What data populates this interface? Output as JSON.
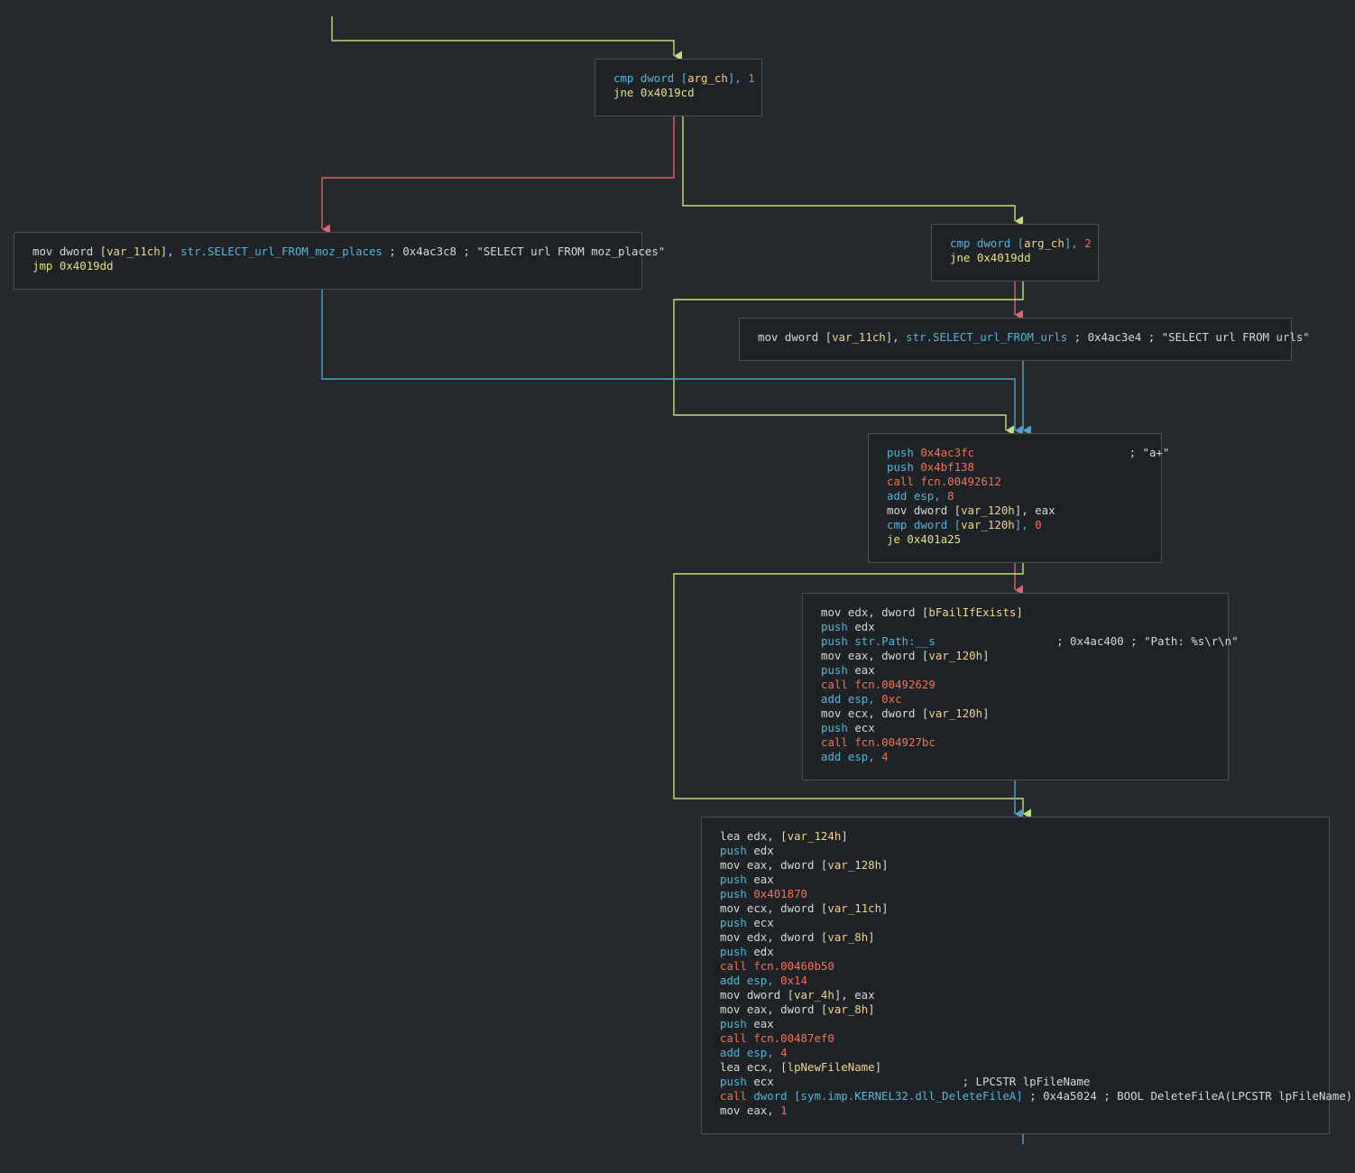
{
  "colors": {
    "background": "#25292d",
    "block_bg": "#1e2125",
    "block_border": "#4a4f55",
    "edge_true": "#bde07a",
    "edge_false": "#e0636b",
    "edge_uncond": "#4fa3c4",
    "mnemonic_default": "#d7dadc",
    "mnemonic_cyan": "#52b8d6",
    "mnemonic_call": "#f0745a",
    "mnemonic_jump": "#e5e27d",
    "operand_var": "#f0d58c",
    "operand_number": "#f0745a"
  },
  "blocks": [
    {
      "id": "b1",
      "lines": [
        {
          "mn": "cmp",
          "c": "cmp",
          "ops": [
            [
              "dword [",
              "c"
            ],
            [
              "arg_ch",
              "y"
            ],
            [
              "], ",
              "c"
            ],
            [
              "1",
              "o"
            ]
          ]
        },
        {
          "mn": "jne",
          "c": "jne",
          "ops": [
            [
              "0x4019cd",
              "j"
            ]
          ]
        }
      ]
    },
    {
      "id": "b2",
      "lines": [
        {
          "mn": "mov",
          "c": "mov",
          "ops": [
            [
              "dword [",
              "w"
            ],
            [
              "var_11ch",
              "y"
            ],
            [
              "], ",
              "w"
            ],
            [
              "str.SELECT_url_FROM_moz_places",
              "c"
            ]
          ],
          "cm": " ; 0x4ac3c8 ; \"SELECT url FROM moz_places\""
        },
        {
          "mn": "jmp",
          "c": "jmp",
          "ops": [
            [
              "0x4019dd",
              "j"
            ]
          ]
        }
      ]
    },
    {
      "id": "b3",
      "lines": [
        {
          "mn": "cmp",
          "c": "cmp",
          "ops": [
            [
              "dword [",
              "c"
            ],
            [
              "arg_ch",
              "y"
            ],
            [
              "], ",
              "c"
            ],
            [
              "2",
              "o"
            ]
          ]
        },
        {
          "mn": "jne",
          "c": "jne",
          "ops": [
            [
              "0x4019dd",
              "j"
            ]
          ]
        }
      ]
    },
    {
      "id": "b4",
      "lines": [
        {
          "mn": "mov",
          "c": "mov",
          "ops": [
            [
              "dword [",
              "w"
            ],
            [
              "var_11ch",
              "y"
            ],
            [
              "], ",
              "w"
            ],
            [
              "str.SELECT_url_FROM_urls",
              "c"
            ]
          ],
          "cm": " ; 0x4ac3e4 ; \"SELECT url FROM urls\""
        }
      ]
    },
    {
      "id": "b5",
      "lines": [
        {
          "mn": "push",
          "c": "push",
          "ops": [
            [
              "0x4ac3fc",
              "o"
            ]
          ],
          "cm": "                       ; \"a+\""
        },
        {
          "mn": "push",
          "c": "push",
          "ops": [
            [
              "0x4bf138",
              "o"
            ]
          ]
        },
        {
          "mn": "call",
          "c": "call",
          "ops": [
            [
              "fcn.00492612",
              "o"
            ]
          ]
        },
        {
          "mn": "add",
          "c": "add",
          "ops": [
            [
              "esp, ",
              "c"
            ],
            [
              "8",
              "o"
            ]
          ]
        },
        {
          "mn": "mov",
          "c": "mov",
          "ops": [
            [
              "dword [",
              "w"
            ],
            [
              "var_120h",
              "y"
            ],
            [
              "], eax",
              "w"
            ]
          ]
        },
        {
          "mn": "cmp",
          "c": "cmp",
          "ops": [
            [
              "dword [",
              "c"
            ],
            [
              "var_120h",
              "y"
            ],
            [
              "], ",
              "c"
            ],
            [
              "0",
              "o"
            ]
          ]
        },
        {
          "mn": "je",
          "c": "je",
          "ops": [
            [
              "0x401a25",
              "j"
            ]
          ]
        }
      ]
    },
    {
      "id": "b6",
      "lines": [
        {
          "mn": "mov",
          "c": "mov",
          "ops": [
            [
              "edx, dword [",
              "w"
            ],
            [
              "bFailIfExists",
              "y"
            ],
            [
              "]",
              "w"
            ]
          ]
        },
        {
          "mn": "push",
          "c": "push",
          "ops": [
            [
              "edx",
              "w"
            ]
          ]
        },
        {
          "mn": "push",
          "c": "push",
          "ops": [
            [
              "str.Path:__s",
              "c"
            ]
          ],
          "cm": "                  ; 0x4ac400 ; \"Path: %s\\r\\n\""
        },
        {
          "mn": "mov",
          "c": "mov",
          "ops": [
            [
              "eax, dword [",
              "w"
            ],
            [
              "var_120h",
              "y"
            ],
            [
              "]",
              "w"
            ]
          ]
        },
        {
          "mn": "push",
          "c": "push",
          "ops": [
            [
              "eax",
              "w"
            ]
          ]
        },
        {
          "mn": "call",
          "c": "call",
          "ops": [
            [
              "fcn.00492629",
              "o"
            ]
          ]
        },
        {
          "mn": "add",
          "c": "add",
          "ops": [
            [
              "esp, ",
              "c"
            ],
            [
              "0xc",
              "o"
            ]
          ]
        },
        {
          "mn": "mov",
          "c": "mov",
          "ops": [
            [
              "ecx, dword [",
              "w"
            ],
            [
              "var_120h",
              "y"
            ],
            [
              "]",
              "w"
            ]
          ]
        },
        {
          "mn": "push",
          "c": "push",
          "ops": [
            [
              "ecx",
              "w"
            ]
          ]
        },
        {
          "mn": "call",
          "c": "call",
          "ops": [
            [
              "fcn.004927bc",
              "o"
            ]
          ]
        },
        {
          "mn": "add",
          "c": "add",
          "ops": [
            [
              "esp, ",
              "c"
            ],
            [
              "4",
              "o"
            ]
          ]
        }
      ]
    },
    {
      "id": "b7",
      "lines": [
        {
          "mn": "lea",
          "c": "mov",
          "ops": [
            [
              "edx, [",
              "w"
            ],
            [
              "var_124h",
              "y"
            ],
            [
              "]",
              "w"
            ]
          ]
        },
        {
          "mn": "push",
          "c": "push",
          "ops": [
            [
              "edx",
              "w"
            ]
          ]
        },
        {
          "mn": "mov",
          "c": "mov",
          "ops": [
            [
              "eax, dword [",
              "w"
            ],
            [
              "var_128h",
              "y"
            ],
            [
              "]",
              "w"
            ]
          ]
        },
        {
          "mn": "push",
          "c": "push",
          "ops": [
            [
              "eax",
              "w"
            ]
          ]
        },
        {
          "mn": "push",
          "c": "push",
          "ops": [
            [
              "0x401870",
              "o"
            ]
          ]
        },
        {
          "mn": "mov",
          "c": "mov",
          "ops": [
            [
              "ecx, dword [",
              "w"
            ],
            [
              "var_11ch",
              "y"
            ],
            [
              "]",
              "w"
            ]
          ]
        },
        {
          "mn": "push",
          "c": "push",
          "ops": [
            [
              "ecx",
              "w"
            ]
          ]
        },
        {
          "mn": "mov",
          "c": "mov",
          "ops": [
            [
              "edx, dword [",
              "w"
            ],
            [
              "var_8h",
              "y"
            ],
            [
              "]",
              "w"
            ]
          ]
        },
        {
          "mn": "push",
          "c": "push",
          "ops": [
            [
              "edx",
              "w"
            ]
          ]
        },
        {
          "mn": "call",
          "c": "call",
          "ops": [
            [
              "fcn.00460b50",
              "o"
            ]
          ]
        },
        {
          "mn": "add",
          "c": "add",
          "ops": [
            [
              "esp, ",
              "c"
            ],
            [
              "0x14",
              "o"
            ]
          ]
        },
        {
          "mn": "mov",
          "c": "mov",
          "ops": [
            [
              "dword [",
              "w"
            ],
            [
              "var_4h",
              "y"
            ],
            [
              "], eax",
              "w"
            ]
          ]
        },
        {
          "mn": "mov",
          "c": "mov",
          "ops": [
            [
              "eax, dword [",
              "w"
            ],
            [
              "var_8h",
              "y"
            ],
            [
              "]",
              "w"
            ]
          ]
        },
        {
          "mn": "push",
          "c": "push",
          "ops": [
            [
              "eax",
              "w"
            ]
          ]
        },
        {
          "mn": "call",
          "c": "call",
          "ops": [
            [
              "fcn.00487ef0",
              "o"
            ]
          ]
        },
        {
          "mn": "add",
          "c": "add",
          "ops": [
            [
              "esp, ",
              "c"
            ],
            [
              "4",
              "o"
            ]
          ]
        },
        {
          "mn": "lea",
          "c": "mov",
          "ops": [
            [
              "ecx, [",
              "w"
            ],
            [
              "lpNewFileName",
              "y"
            ],
            [
              "]",
              "w"
            ]
          ]
        },
        {
          "mn": "push",
          "c": "push",
          "ops": [
            [
              "ecx",
              "w"
            ]
          ],
          "cm": "                            ; LPCSTR lpFileName"
        },
        {
          "mn": "call",
          "c": "call",
          "ops": [
            [
              "dword [",
              "c"
            ],
            [
              "sym.imp.KERNEL32.dll_DeleteFileA",
              "c"
            ],
            [
              "]",
              "c"
            ]
          ],
          "cm": " ; 0x4a5024 ; BOOL DeleteFileA(LPCSTR lpFileName)"
        },
        {
          "mn": "mov",
          "c": "mov",
          "ops": [
            [
              "eax, ",
              "w"
            ],
            [
              "1",
              "o"
            ]
          ]
        }
      ]
    }
  ]
}
